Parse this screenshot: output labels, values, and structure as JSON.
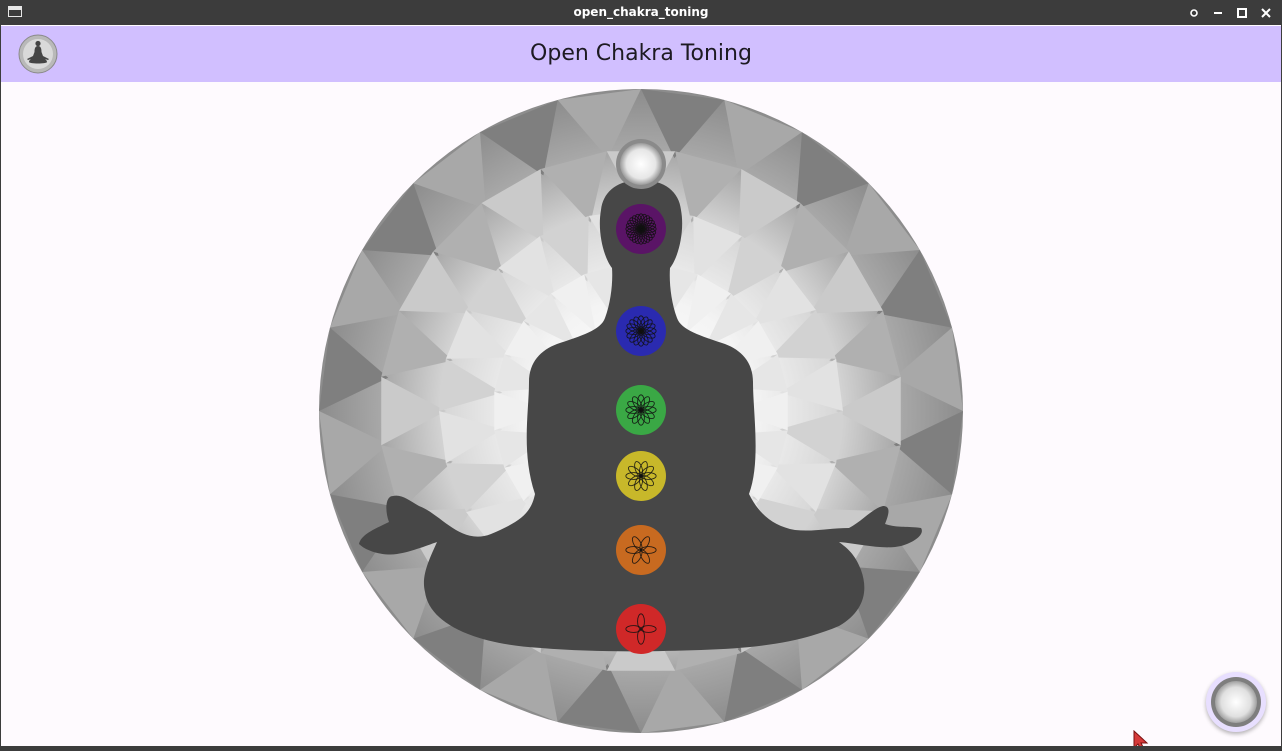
{
  "window": {
    "title": "open_chakra_toning",
    "controls": [
      "pin-icon",
      "minimize-icon",
      "maximize-icon",
      "close-icon"
    ]
  },
  "appbar": {
    "title": "Open Chakra Toning",
    "avatar_icon": "meditation-figure-icon"
  },
  "mandala": {
    "figure": "meditating-person-silhouette",
    "chakras": [
      {
        "name": "crown-aura",
        "color": "#f5f5f5",
        "petals": 24
      },
      {
        "name": "crown",
        "color": "#5a1466",
        "petals": 24
      },
      {
        "name": "third-eye",
        "color": "#2a2ab0",
        "petals": 16
      },
      {
        "name": "heart",
        "color": "#3aa845",
        "petals": 12
      },
      {
        "name": "solar-plexus",
        "color": "#c8b82a",
        "petals": 10
      },
      {
        "name": "sacral",
        "color": "#c86a20",
        "petals": 6
      },
      {
        "name": "root",
        "color": "#d02828",
        "petals": 4
      }
    ]
  },
  "fab": {
    "icon": "crown-aura-icon"
  },
  "colors": {
    "titlebar": "#3c3c3c",
    "appbar": "#d1bfff",
    "background": "#fefafe",
    "silhouette": "#474747"
  }
}
